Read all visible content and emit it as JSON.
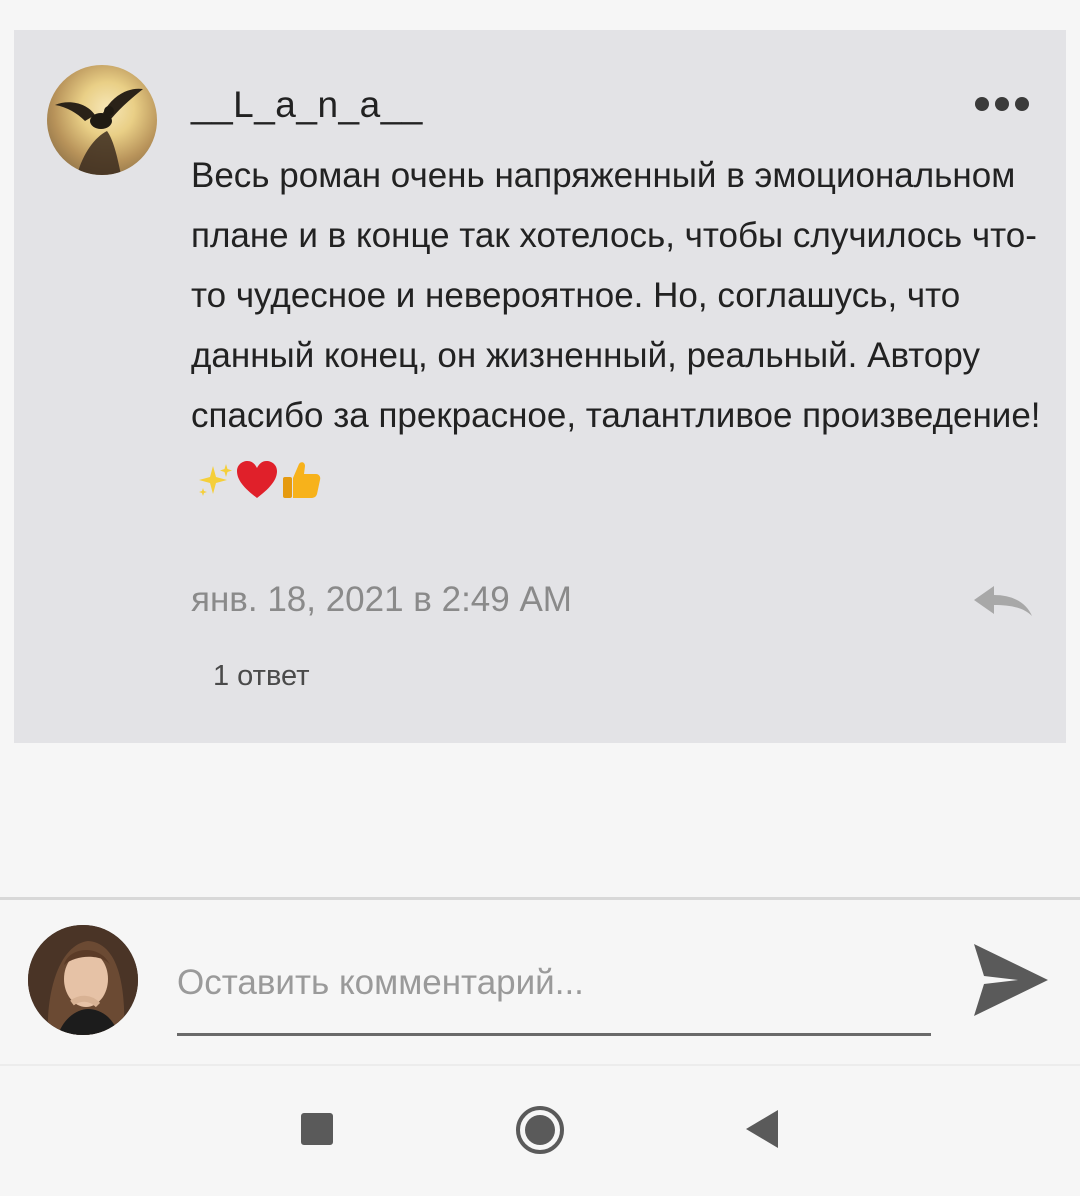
{
  "comment": {
    "username": "__L_a_n_a__",
    "text": "Весь роман очень напряженный в эмоциональном плане и в конце так хотелось, чтобы случилось что-то чудесное и невероятное. Но, соглашусь, что данный конец, он жизненный, реальный. Автору спасибо за прекрасное, талантливое произведение!",
    "emojis": [
      "sparkles",
      "red-heart",
      "thumbs-up"
    ],
    "timestamp": "янв. 18, 2021 в 2:49 AM",
    "replies_label": "1 ответ",
    "more_icon": "more-horizontal-icon",
    "reply_icon": "reply-arrow-icon"
  },
  "composer": {
    "placeholder": "Оставить комментарий...",
    "send_icon": "send-icon"
  },
  "navbar": {
    "icons": [
      "square-recents-icon",
      "circle-home-icon",
      "triangle-back-icon"
    ]
  },
  "colors": {
    "card_background": "#e3e3e6",
    "page_background": "#f6f6f6",
    "text_primary": "#222222",
    "text_secondary": "#8a8a8a"
  }
}
